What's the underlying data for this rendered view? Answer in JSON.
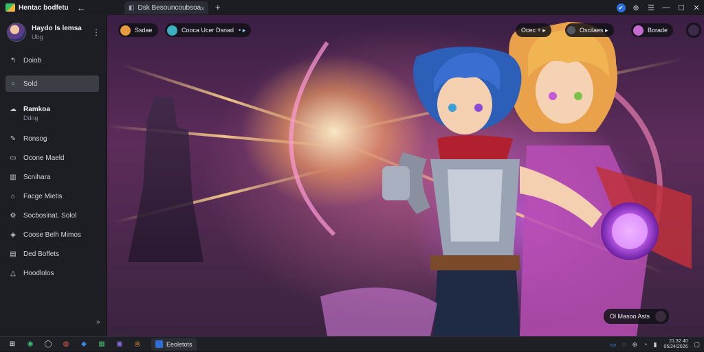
{
  "window": {
    "app_title": "Hentac bodfetu",
    "tab_label": "Dsk Besouncoubsoa s",
    "tab_close": "x",
    "new_tab": "+"
  },
  "profile": {
    "name": "Haydo ls lemsa",
    "sub": "Ubg"
  },
  "sidebar": {
    "items": [
      {
        "label": "Doiob",
        "icon": "arrow-icon"
      },
      {
        "label": "Sold",
        "icon": "circle-icon"
      },
      {
        "label": "Ramkoa",
        "sub": "Ddng",
        "icon": "cloud-icon"
      },
      {
        "label": "Ronsog",
        "icon": "paint-icon"
      },
      {
        "label": "Ocone Maeld",
        "icon": "folder-icon"
      },
      {
        "label": "Scnihara",
        "icon": "chart-icon"
      },
      {
        "label": "Facge Mietis",
        "icon": "cart-icon"
      },
      {
        "label": "Socbosinat. Solol",
        "icon": "gear-icon"
      },
      {
        "label": "Coose Belh Mimos",
        "icon": "shield-icon"
      },
      {
        "label": "Ded Boffets",
        "icon": "document-icon"
      },
      {
        "label": "Hoodlolos",
        "icon": "warning-icon"
      }
    ],
    "collapse": "»"
  },
  "viewer": {
    "chip1": "Ssdae",
    "chip2": "Cooca Ucer Dsnad",
    "chip2_extra": "• ▸",
    "chip3": "Ocec + ▸",
    "chip4": "Oscilaes ▸",
    "chip5": "Borade",
    "badge": "Ol Masoo Asts"
  },
  "taskbar": {
    "active_app": "Eeoletots"
  },
  "tray": {
    "time": "21:32 40",
    "date": "05/24/2026"
  },
  "colors": {
    "accent": "#2b6fdc",
    "sidebar_bg": "#1c1e23",
    "active_item": "#3b3e45"
  }
}
